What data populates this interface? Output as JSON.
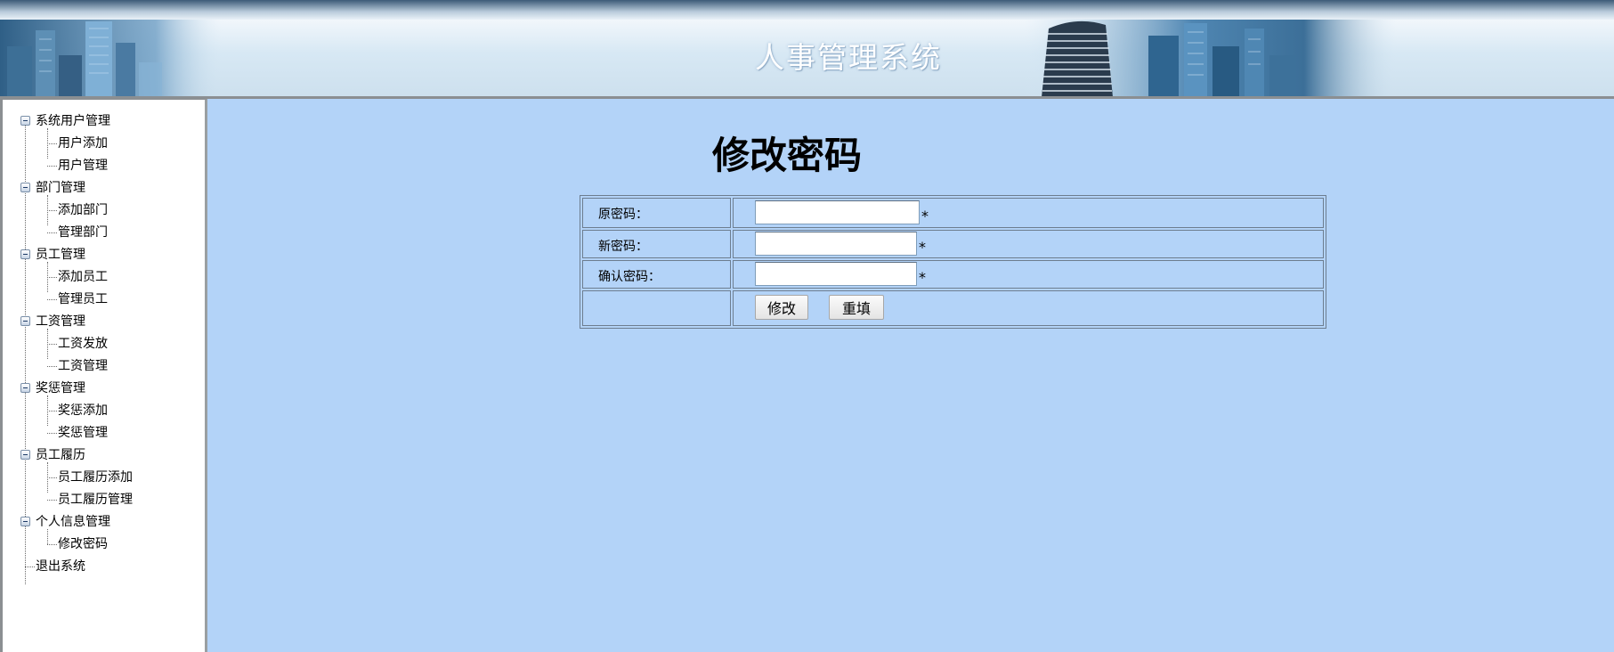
{
  "header": {
    "title": "人事管理系统"
  },
  "sidebar": {
    "groups": [
      {
        "label": "系统用户管理",
        "items": [
          "用户添加",
          "用户管理"
        ]
      },
      {
        "label": "部门管理",
        "items": [
          "添加部门",
          "管理部门"
        ]
      },
      {
        "label": "员工管理",
        "items": [
          "添加员工",
          "管理员工"
        ]
      },
      {
        "label": "工资管理",
        "items": [
          "工资发放",
          "工资管理"
        ]
      },
      {
        "label": "奖惩管理",
        "items": [
          "奖惩添加",
          "奖惩管理"
        ]
      },
      {
        "label": "员工履历",
        "items": [
          "员工履历添加",
          "员工履历管理"
        ]
      },
      {
        "label": "个人信息管理",
        "items": [
          "修改密码"
        ]
      }
    ],
    "logout": "退出系统"
  },
  "main": {
    "title": "修改密码",
    "form": {
      "old_password_label": "原密码：",
      "new_password_label": "新密码：",
      "confirm_password_label": "确认密码：",
      "old_password_value": "",
      "new_password_value": "",
      "confirm_password_value": "",
      "required_mark": "*",
      "submit_label": "修改",
      "reset_label": "重填"
    }
  },
  "colors": {
    "content_bg": "#b3d3f8",
    "sidebar_bg": "#ffffff",
    "border": "#6d7d8f"
  }
}
